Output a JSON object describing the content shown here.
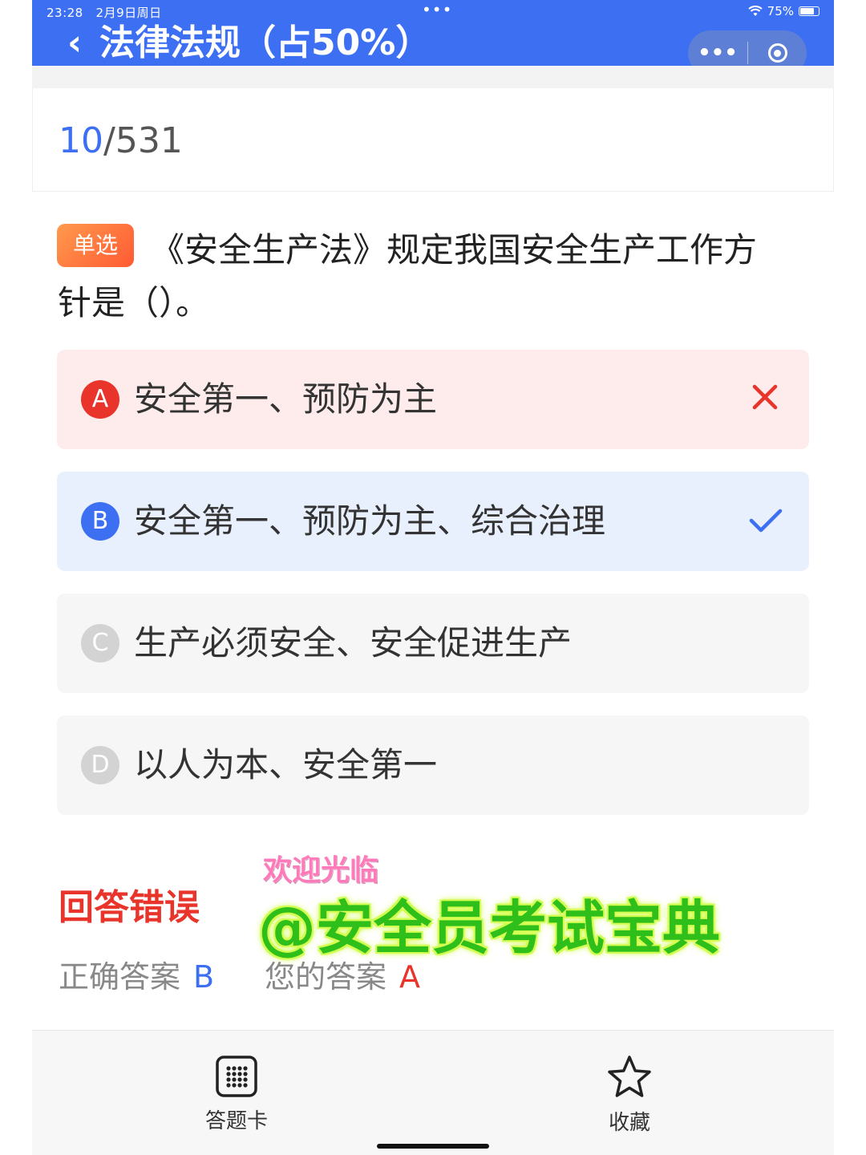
{
  "status_bar": {
    "time": "23:28",
    "date": "2月9日周日",
    "dots": "•••",
    "battery_percent": "75%"
  },
  "header": {
    "back_icon": "‹",
    "title": "法律法规（占50%）",
    "capsule_more": "•••",
    "accent_color": "#3d6ff2"
  },
  "progress": {
    "current": "10",
    "slash": "/",
    "total": "531"
  },
  "question": {
    "type_badge": "单选",
    "text_line1": "《安全生产法》规定我国安全生产工作方",
    "text_line2": "针是（）。"
  },
  "options": [
    {
      "letter": "A",
      "text": "安全第一、预防为主",
      "state": "wrong"
    },
    {
      "letter": "B",
      "text": "安全第一、预防为主、综合治理",
      "state": "correct"
    },
    {
      "letter": "C",
      "text": "生产必须安全、安全促进生产",
      "state": "none"
    },
    {
      "letter": "D",
      "text": "以人为本、安全第一",
      "state": "none"
    }
  ],
  "result": {
    "title": "回答错误",
    "correct_label": "正确答案",
    "correct_value": "B",
    "your_label": "您的答案",
    "your_value": "A"
  },
  "watermark": {
    "small": "欢迎光临",
    "big": "@安全员考试宝典"
  },
  "bottom_bar": {
    "answer_card_label": "答题卡",
    "favorite_label": "收藏"
  },
  "colors": {
    "wrong": "#e8342b",
    "correct": "#3d6ff2",
    "badge": "#ff6a3d"
  }
}
